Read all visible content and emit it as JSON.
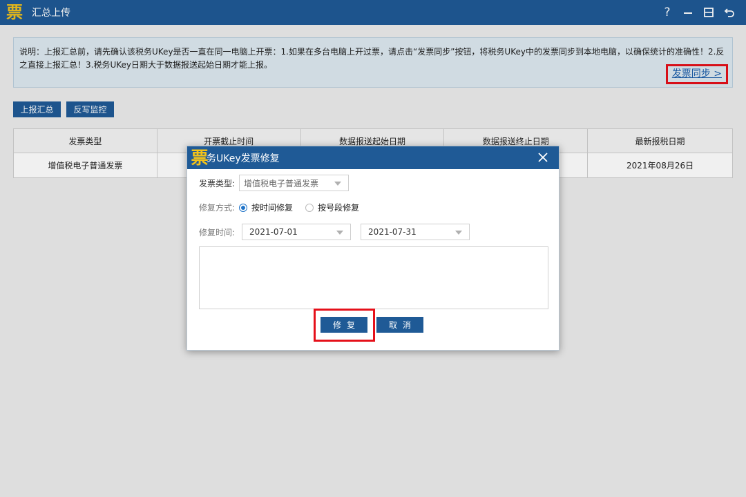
{
  "app": {
    "title": "汇总上传",
    "logo_char": "票",
    "controls": {
      "help": "?"
    }
  },
  "notice": {
    "text": "说明：上报汇总前，请先确认该税务UKey是否一直在同一电脑上开票：1.如果在多台电脑上开过票，请点击“发票同步”按钮，将税务UKey中的发票同步到本地电脑，以确保统计的准确性！2.反之直接上报汇总！3.税务UKey日期大于数据报送起始日期才能上报。",
    "sync_link": "发票同步 >"
  },
  "toolbar": {
    "report_label": "上报汇总",
    "monitor_label": "反写监控"
  },
  "table": {
    "headers": [
      "发票类型",
      "开票截止时间",
      "数据报送起始日期",
      "数据报送终止日期",
      "最新报税日期"
    ],
    "rows": [
      [
        "增值税电子普通发票",
        "",
        "",
        "",
        "2021年08月26日"
      ]
    ]
  },
  "dialog": {
    "logo_char": "票",
    "title": "务UKey发票修复",
    "type_label": "发票类型:",
    "type_value": "增值税电子普通发票",
    "mode_label": "修复方式:",
    "mode_options": [
      "按时间修复",
      "按号段修复"
    ],
    "mode_selected": 0,
    "time_label": "修复时间:",
    "date_start": "2021-07-01",
    "date_end": "2021-07-31",
    "repair_label": "修复",
    "cancel_label": "取消"
  },
  "colors": {
    "brand": "#1f5a96",
    "highlight": "#e5101a",
    "logo": "#f2c21b",
    "link": "#1a5dab"
  }
}
